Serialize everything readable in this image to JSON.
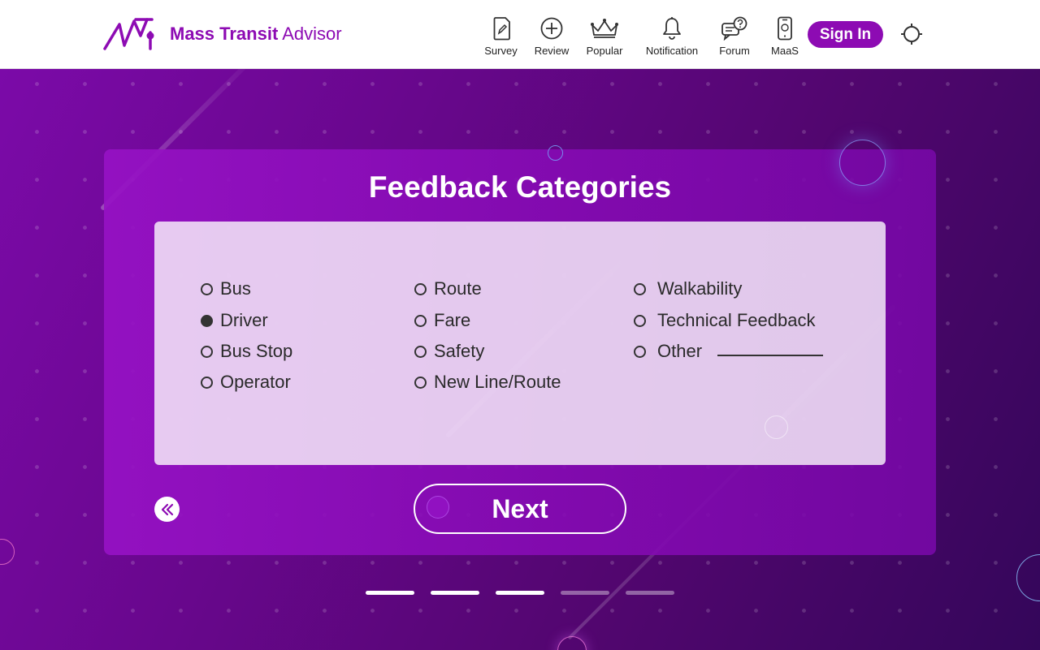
{
  "app": {
    "brand_bold": "Mass Transit",
    "brand_light": "Advisor",
    "accent_color": "#8d0bb3"
  },
  "nav": {
    "items": [
      {
        "label": "Survey",
        "icon": "survey-icon"
      },
      {
        "label": "Review",
        "icon": "review-plus-icon"
      },
      {
        "label": "Popular",
        "icon": "crown-icon"
      },
      {
        "label": "Notification",
        "icon": "bell-icon"
      },
      {
        "label": "Forum",
        "icon": "chat-question-icon"
      },
      {
        "label": "MaaS",
        "icon": "phone-icon"
      }
    ],
    "signin_label": "Sign In",
    "theme_icon": "sun-icon"
  },
  "feedback": {
    "title": "Feedback Categories",
    "columns": [
      [
        {
          "label": "Bus",
          "checked": false
        },
        {
          "label": "Driver",
          "checked": true
        },
        {
          "label": "Bus Stop",
          "checked": false
        },
        {
          "label": "Operator",
          "checked": false
        }
      ],
      [
        {
          "label": "Route",
          "checked": false
        },
        {
          "label": "Fare",
          "checked": false
        },
        {
          "label": "Safety",
          "checked": false
        },
        {
          "label": "New Line/Route",
          "checked": false
        }
      ],
      [
        {
          "label": "Walkability",
          "checked": false
        },
        {
          "label": "Technical Feedback",
          "checked": false
        },
        {
          "label": "Other",
          "checked": false
        }
      ]
    ],
    "next_label": "Next",
    "back_icon": "double-chevron-left-icon"
  },
  "progress": {
    "total_steps": 5,
    "completed_steps": 3
  }
}
